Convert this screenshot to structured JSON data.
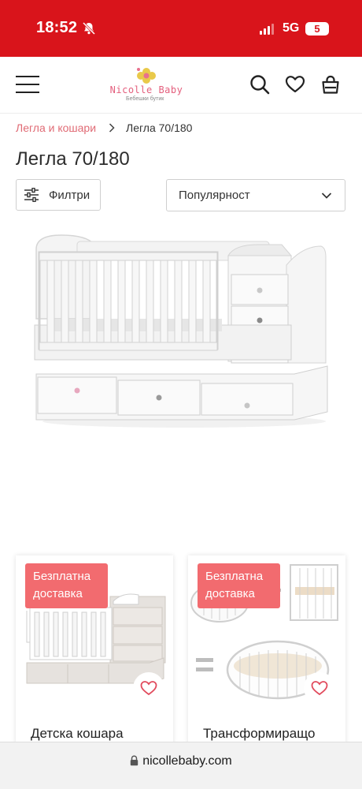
{
  "status": {
    "time": "18:52",
    "network": "5G",
    "battery": "5",
    "bell_icon": "bell-slash-icon",
    "background_color": "#d9141b"
  },
  "header": {
    "logo": {
      "name": "Nicolle Baby",
      "tagline": "Бебешки бутик"
    },
    "menu_icon": "hamburger-menu-icon",
    "search_icon": "search-icon",
    "wishlist_icon": "heart-icon",
    "cart_icon": "shopping-bag-icon"
  },
  "breadcrumb": {
    "parent": "Легла и кошари",
    "separator_icon": "chevron-right-icon",
    "current": "Легла 70/180"
  },
  "page": {
    "title": "Легла 70/180"
  },
  "toolbar": {
    "filter_label": "Филтри",
    "filter_icon": "sliders-icon",
    "sort_value": "Популярност",
    "sort_icon": "chevron-down-icon"
  },
  "products": [
    {
      "badge": "Безплатна доставка",
      "title": "Детска кошара",
      "image": "crib-with-drawers-grey",
      "wishlist_icon": "heart-outline-icon"
    },
    {
      "badge": "Безплатна доставка",
      "title": "Трансформиращо",
      "image": "convertible-oval-crib",
      "wishlist_icon": "heart-outline-icon"
    }
  ],
  "browser": {
    "url": "nicollebaby.com",
    "lock_icon": "lock-icon"
  },
  "colors": {
    "accent": "#e06b75",
    "badge": "#f26b6f"
  }
}
